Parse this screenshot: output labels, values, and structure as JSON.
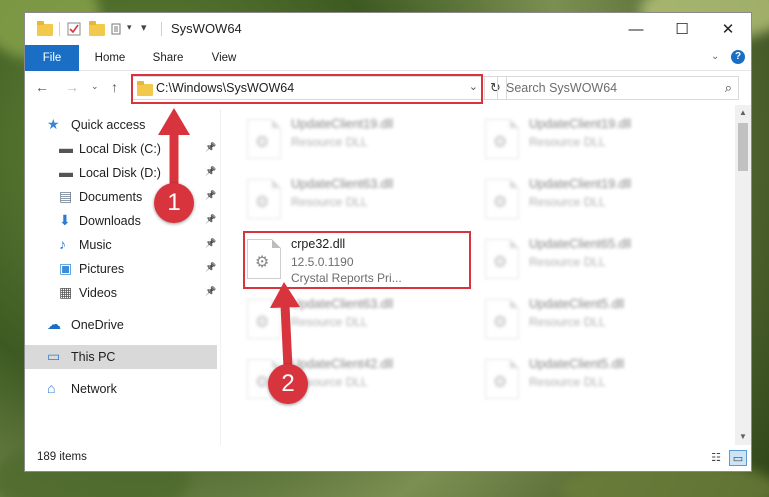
{
  "colors": {
    "accent": "#1a6fc4",
    "highlight_red": "#d8343d",
    "selected_bg": "#d9d9d9"
  },
  "window": {
    "title": "SysWOW64",
    "minimize_icon": "minimize-icon",
    "maximize_icon": "maximize-icon",
    "close_icon": "close-icon"
  },
  "ribbon": {
    "tabs": [
      "File",
      "Home",
      "Share",
      "View"
    ]
  },
  "address": {
    "path": "C:\\Windows\\SysWOW64"
  },
  "search": {
    "placeholder": "Search SysWOW64"
  },
  "nav": {
    "items": [
      {
        "label": "Quick access",
        "icon": "star-icon",
        "pinned": false
      },
      {
        "label": "Local Disk (C:)",
        "icon": "drive-icon",
        "pinned": true
      },
      {
        "label": "Local Disk (D:)",
        "icon": "drive-icon",
        "pinned": true
      },
      {
        "label": "Documents",
        "icon": "documents-icon",
        "pinned": true
      },
      {
        "label": "Downloads",
        "icon": "downloads-icon",
        "pinned": true
      },
      {
        "label": "Music",
        "icon": "music-icon",
        "pinned": true
      },
      {
        "label": "Pictures",
        "icon": "pictures-icon",
        "pinned": true
      },
      {
        "label": "Videos",
        "icon": "videos-icon",
        "pinned": true
      },
      {
        "label": "OneDrive",
        "icon": "onedrive-icon",
        "pinned": false
      },
      {
        "label": "This PC",
        "icon": "pc-icon",
        "pinned": false,
        "selected": true
      },
      {
        "label": "Network",
        "icon": "network-icon",
        "pinned": false
      }
    ]
  },
  "files": [
    {
      "name": "UpdateClient19.dll",
      "line2": "Resource DLL",
      "blurred": true
    },
    {
      "name": "UpdateClient19.dll",
      "line2": "Resource DLL",
      "blurred": true
    },
    {
      "name": "UpdateClient63.dll",
      "line2": "Resource DLL",
      "blurred": true
    },
    {
      "name": "UpdateClient19.dll",
      "line2": "Resource DLL",
      "blurred": true
    },
    {
      "name": "crpe32.dll",
      "line2": "12.5.0.1190",
      "line3": "Crystal Reports Pri...",
      "blurred": false
    },
    {
      "name": "UpdateClient65.dll",
      "line2": "Resource DLL",
      "blurred": true
    },
    {
      "name": "UpdateClient63.dll",
      "line2": "Resource DLL",
      "blurred": true
    },
    {
      "name": "UpdateClient5.dll",
      "line2": "Resource DLL",
      "blurred": true
    },
    {
      "name": "UpdateClient42.dll",
      "line2": "Resource DLL",
      "blurred": true
    },
    {
      "name": "UpdateClient5.dll",
      "line2": "Resource DLL",
      "blurred": true
    }
  ],
  "status": {
    "item_count": "189 items"
  },
  "annotations": {
    "step1": "1",
    "step2": "2"
  }
}
